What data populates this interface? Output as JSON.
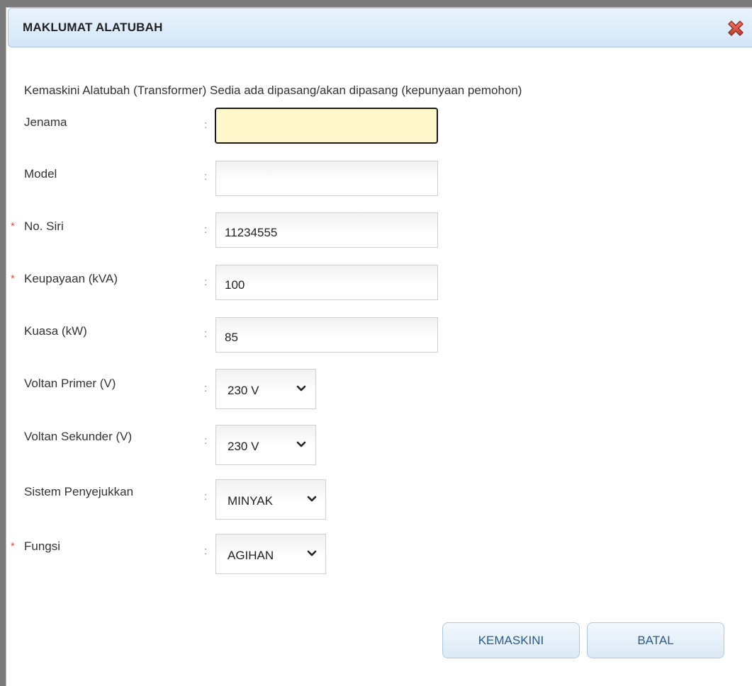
{
  "dialog": {
    "title": "MAKLUMAT ALATUBAH",
    "close_icon": "close-x-icon",
    "intro": "Kemaskini Alatubah (Transformer) Sedia ada dipasang/akan dipasang (kepunyaan pemohon)"
  },
  "form": {
    "colon": ":",
    "required_mark": "*",
    "jenama": {
      "label": "Jenama",
      "value": ""
    },
    "model": {
      "label": "Model",
      "value": ""
    },
    "no_siri": {
      "label": "No. Siri",
      "value": "11234555"
    },
    "keupayaan": {
      "label": "Keupayaan (kVA)",
      "value": "100"
    },
    "kuasa": {
      "label": "Kuasa (kW)",
      "value": "85"
    },
    "voltan_primer": {
      "label": "Voltan Primer (V)",
      "selected": "230 V"
    },
    "voltan_sekunder": {
      "label": "Voltan Sekunder (V)",
      "selected": "230 V"
    },
    "sistem_penyejukkan": {
      "label": "Sistem Penyejukkan",
      "selected": "MINYAK"
    },
    "fungsi": {
      "label": "Fungsi",
      "selected": "AGIHAN"
    }
  },
  "buttons": {
    "update": "KEMASKINI",
    "cancel": "BATAL"
  },
  "colors": {
    "title_bar": "#d3e6f7",
    "focused_field": "#fff8cc",
    "required": "#d9534f",
    "button_text": "#2c5a8a"
  }
}
